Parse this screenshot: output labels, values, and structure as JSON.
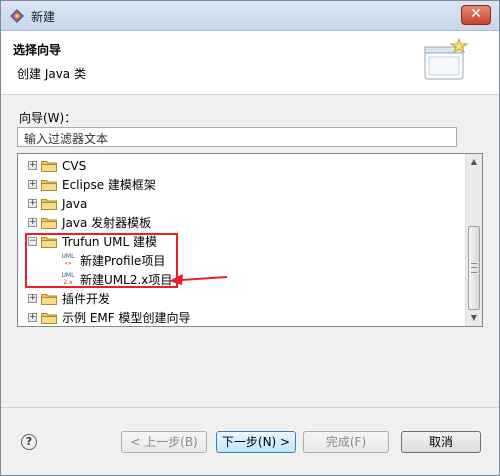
{
  "window": {
    "title": "新建"
  },
  "header": {
    "title": "选择向导",
    "description": "创建 Java 类"
  },
  "filter": {
    "label": "向导(W)：",
    "placeholder": "输入过滤器文本"
  },
  "tree": {
    "items": [
      {
        "label": "CVS",
        "expander": "+",
        "kind": "folder"
      },
      {
        "label": "Eclipse 建模框架",
        "expander": "+",
        "kind": "folder"
      },
      {
        "label": "Java",
        "expander": "+",
        "kind": "folder"
      },
      {
        "label": "Java 发射器模板",
        "expander": "+",
        "kind": "folder"
      },
      {
        "label": "Trufun UML 建模",
        "expander": "−",
        "kind": "folder"
      },
      {
        "label": "新建Profile项目",
        "kind": "uml-profile"
      },
      {
        "label": "新建UML2.x项目",
        "kind": "uml2"
      },
      {
        "label": "插件开发",
        "expander": "+",
        "kind": "folder"
      },
      {
        "label": "示例 EMF 模型创建向导",
        "expander": "+",
        "kind": "folder"
      }
    ]
  },
  "icons": {
    "uml_text": "UML",
    "uml_sub1": "«»",
    "uml_sub2": "2.x"
  },
  "buttons": {
    "back": "< 上一步(B)",
    "next": "下一步(N) >",
    "finish": "完成(F)",
    "cancel": "取消"
  },
  "colors": {
    "highlight": "#e8202a",
    "folder": "#f0c75e"
  }
}
